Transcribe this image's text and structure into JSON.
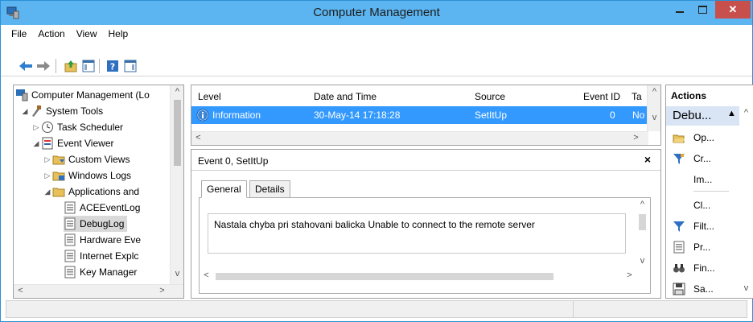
{
  "window": {
    "title": "Computer Management"
  },
  "menu": {
    "items": [
      "File",
      "Action",
      "View",
      "Help"
    ]
  },
  "tree": {
    "items": [
      {
        "label": "Computer Management (Lo",
        "icon": "computer-management-icon"
      },
      {
        "label": "System Tools",
        "icon": "system-tools-icon"
      },
      {
        "label": "Task Scheduler",
        "icon": "clock-icon"
      },
      {
        "label": "Event Viewer",
        "icon": "event-viewer-icon"
      },
      {
        "label": "Custom Views",
        "icon": "folder-filter-icon"
      },
      {
        "label": "Windows Logs",
        "icon": "folder-logs-icon"
      },
      {
        "label": "Applications and",
        "icon": "folder-icon"
      },
      {
        "label": "ACEEventLog",
        "icon": "log-icon"
      },
      {
        "label": "DebugLog",
        "icon": "log-icon"
      },
      {
        "label": "Hardware Eve",
        "icon": "log-icon"
      },
      {
        "label": "Internet Explc",
        "icon": "log-icon"
      },
      {
        "label": "Key Manager",
        "icon": "log-icon"
      }
    ]
  },
  "events": {
    "columns": [
      "Level",
      "Date and Time",
      "Source",
      "Event ID",
      "Ta"
    ],
    "rows": [
      {
        "level": "Information",
        "date": "30-May-14 17:18:28",
        "source": "SetItUp",
        "event_id": "0",
        "task": "No"
      }
    ]
  },
  "detail": {
    "title": "Event 0, SetItUp",
    "close": "×",
    "tabs": [
      "General",
      "Details"
    ],
    "message": "Nastala chyba pri stahovani balicka Unable to connect to the remote server"
  },
  "actions": {
    "title": "Actions",
    "section": "Debu...",
    "items": [
      {
        "label": "Op...",
        "icon": "open-folder-icon"
      },
      {
        "label": "Cr...",
        "icon": "filter-icon"
      },
      {
        "label": "Im...",
        "icon": ""
      },
      {
        "label": "Cl...",
        "icon": ""
      },
      {
        "label": "Filt...",
        "icon": "filter-icon"
      },
      {
        "label": "Pr...",
        "icon": "properties-icon"
      },
      {
        "label": "Fin...",
        "icon": "find-icon"
      },
      {
        "label": "Sa...",
        "icon": "save-icon"
      }
    ]
  },
  "colors": {
    "titlebar": "#5cb5f0",
    "selection": "#3399ff",
    "close": "#c7504d"
  }
}
